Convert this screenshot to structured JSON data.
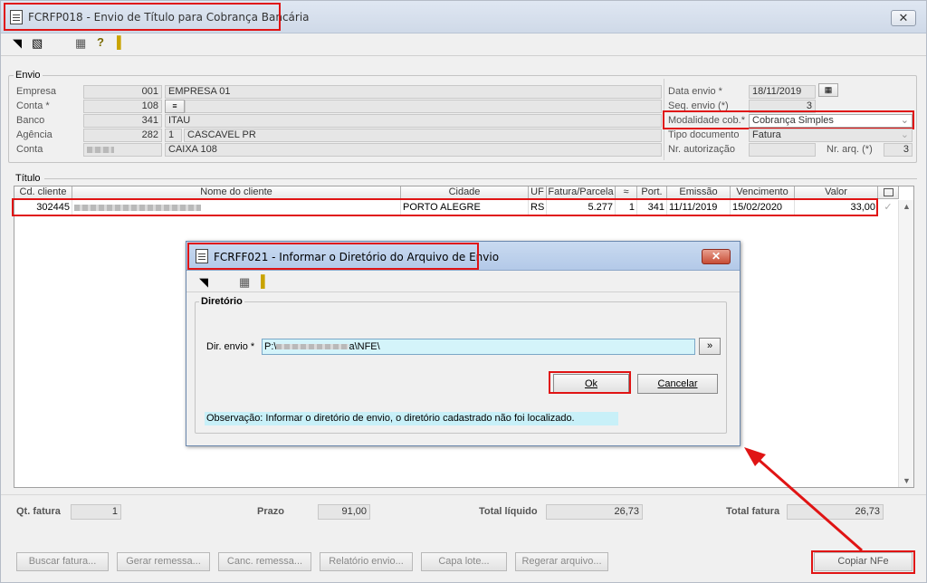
{
  "window": {
    "title": "FCRFP018 - Envio de Título para Cobrança Bancária",
    "close_glyph": "✕"
  },
  "toolbar": {
    "icons": [
      "execute-icon",
      "selection-icon",
      "calendar-icon",
      "help-icon",
      "exit-door-icon"
    ]
  },
  "envio": {
    "group_label": "Envio",
    "empresa": {
      "label": "Empresa",
      "code": "001",
      "name": "EMPRESA 01"
    },
    "conta_req": {
      "label": "Conta *",
      "code": "108"
    },
    "banco": {
      "label": "Banco",
      "code": "341",
      "name": "ITAU"
    },
    "agencia": {
      "label": "Agência",
      "code": "282",
      "digit": "1",
      "name": "CASCAVEL PR"
    },
    "conta": {
      "label": "Conta",
      "name": "CAIXA 108"
    },
    "data_envio": {
      "label": "Data envio *",
      "value": "18/11/2019"
    },
    "seq_envio": {
      "label": "Seq. envio (*)",
      "value": "3"
    },
    "modalidade": {
      "label": "Modalidade cob.*",
      "value": "Cobrança Simples"
    },
    "tipo_documento": {
      "label": "Tipo documento",
      "value": "Fatura"
    },
    "nr_autorizacao": {
      "label": "Nr. autorização",
      "value": ""
    },
    "nr_arq": {
      "label": "Nr. arq. (*)",
      "value": "3"
    }
  },
  "titulo": {
    "group_label": "Título",
    "columns": [
      "Cd. cliente",
      "Nome do cliente",
      "Cidade",
      "UF",
      "Fatura/Parcela",
      "",
      "Port.",
      "Emissão",
      "Vencimento",
      "Valor"
    ],
    "rows": [
      {
        "cd_cliente": "302445",
        "cidade": "PORTO ALEGRE",
        "uf": "RS",
        "fatura": "5.277",
        "parcela": "1",
        "port": "341",
        "emissao": "11/11/2019",
        "vencimento": "15/02/2020",
        "valor": "33,00"
      }
    ]
  },
  "footer": {
    "qt_fatura": {
      "label": "Qt. fatura",
      "value": "1"
    },
    "prazo": {
      "label": "Prazo",
      "value": "91,00"
    },
    "total_liquido": {
      "label": "Total líquido",
      "value": "26,73"
    },
    "total_fatura": {
      "label": "Total fatura",
      "value": "26,73"
    }
  },
  "buttons": {
    "buscar_fatura": "Buscar fatura...",
    "gerar_remessa": "Gerar remessa...",
    "canc_remessa": "Canc. remessa...",
    "relatorio_envio": "Relatório envio...",
    "capa_lote": "Capa lote...",
    "regerar_arquivo": "Regerar arquivo...",
    "copiar_nfe": "Copiar NFe"
  },
  "dialog": {
    "title": "FCRFF021 - Informar o Diretório do Arquivo de Envio",
    "group_label": "Diretório",
    "dir_label": "Dir. envio *",
    "dir_value_prefix": "P:\\",
    "dir_value_suffix": "a\\NFE\\",
    "browse_label": "»",
    "ok_label": "Ok",
    "cancel_label": "Cancelar",
    "observacao": "Observação: Informar o diretório de envio, o diretório cadastrado não foi localizado."
  }
}
